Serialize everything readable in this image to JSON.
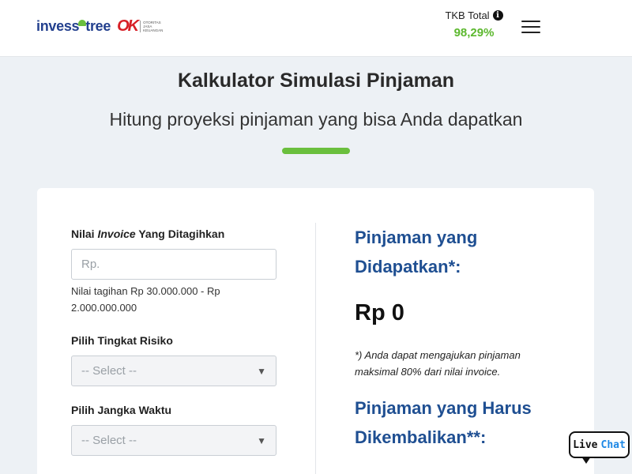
{
  "header": {
    "logo": {
      "brand_part1": "inves",
      "brand_part2": "ree",
      "ojk_mark": "OK",
      "ojk_sub_line1": "OTORITAS",
      "ojk_sub_line2": "JASA",
      "ojk_sub_line3": "KEUANGAN"
    },
    "tkb_label": "TKB Total",
    "tkb_value": "98,29%",
    "info_icon": "i",
    "menu_icon": "hamburger-icon"
  },
  "hero": {
    "title": "Kalkulator Simulasi Pinjaman",
    "subtitle": "Hitung proyeksi pinjaman yang bisa Anda dapatkan"
  },
  "form": {
    "invoice_label_prefix": "Nilai ",
    "invoice_label_em": "Invoice",
    "invoice_label_suffix": " Yang Ditagihkan",
    "invoice_placeholder": "Rp.",
    "invoice_value": "",
    "invoice_helper": "Nilai tagihan Rp 30.000.000 - Rp 2.000.000.000",
    "risk_label": "Pilih Tingkat Risiko",
    "risk_selected": "-- Select --",
    "term_label": "Pilih Jangka Waktu",
    "term_selected": "-- Select --",
    "caret": "▼"
  },
  "results": {
    "loan_heading": "Pinjaman yang Didapatkan*:",
    "loan_amount": "Rp 0",
    "loan_note": "*) Anda dapat mengajukan pinjaman maksimal 80% dari nilai invoice.",
    "repay_heading": "Pinjaman yang Harus Dikembalikan**:"
  },
  "live_chat": {
    "live": "Live",
    "chat": "Chat"
  },
  "colors": {
    "accent_green": "#6abf3d",
    "tkb_green": "#5cb82e",
    "heading_blue": "#1f4f92",
    "brand_blue": "#23408e",
    "ojk_red": "#d71f26",
    "chat_blue": "#1e88e5"
  }
}
